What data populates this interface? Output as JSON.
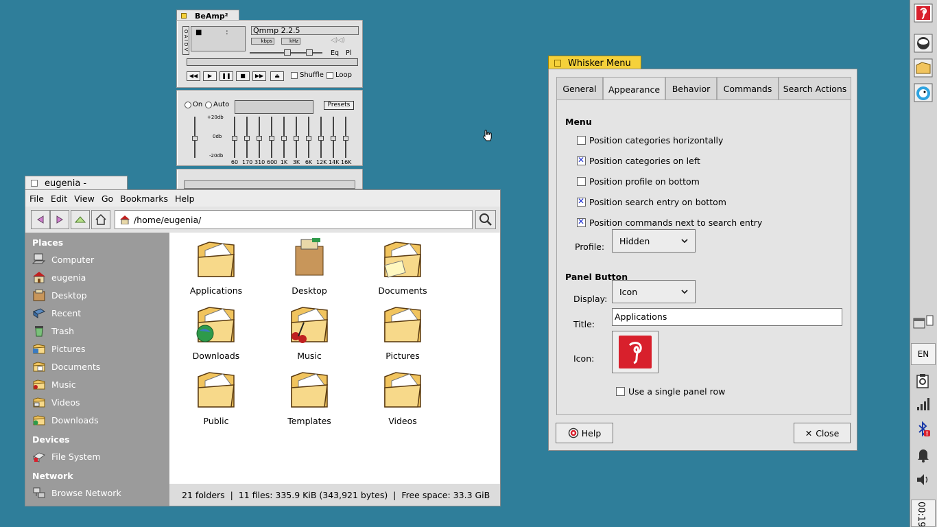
{
  "beamp": {
    "title": "BeAmp²",
    "track": "Qmmp 2.2.5",
    "kbps": "kbps",
    "khz": "kHz",
    "eq": "Eq",
    "pl": "Pl",
    "shuffle": "Shuffle",
    "loop": "Loop",
    "side_letters": "O A I D V",
    "time": ":",
    "eq_on": "On",
    "eq_auto": "Auto",
    "presets": "Presets",
    "db_top": "+20db",
    "db_mid": "0db",
    "db_bot": "-20db",
    "bands": [
      "60",
      "170",
      "310",
      "600",
      "1K",
      "3K",
      "6K",
      "12K",
      "14K",
      "16K"
    ]
  },
  "thunar": {
    "title": "eugenia - Thunar",
    "menu": [
      "File",
      "Edit",
      "View",
      "Go",
      "Bookmarks",
      "Help"
    ],
    "location": "/home/eugenia/",
    "places_header": "Places",
    "places": [
      "Computer",
      "eugenia",
      "Desktop",
      "Recent",
      "Trash",
      "Pictures",
      "Documents",
      "Music",
      "Videos",
      "Downloads"
    ],
    "devices_header": "Devices",
    "devices": [
      "File System"
    ],
    "network_header": "Network",
    "network": [
      "Browse Network"
    ],
    "folders": [
      "Applications",
      "Desktop",
      "Documents",
      "Downloads",
      "Music",
      "Pictures",
      "Public",
      "Templates",
      "Videos"
    ],
    "status": "21 folders  |  11 files: 335.9 KiB (343,921 bytes)  |  Free space: 33.3 GiB"
  },
  "whisker": {
    "title": "Whisker Menu",
    "tabs": [
      "General",
      "Appearance",
      "Behavior",
      "Commands",
      "Search Actions"
    ],
    "active_tab": "Appearance",
    "menu_header": "Menu",
    "options": [
      {
        "label": "Position categories horizontally",
        "checked": false
      },
      {
        "label": "Position categories on left",
        "checked": true
      },
      {
        "label": "Position profile on bottom",
        "checked": false
      },
      {
        "label": "Position search entry on bottom",
        "checked": true
      },
      {
        "label": "Position commands next to search entry",
        "checked": true
      }
    ],
    "profile_label": "Profile:",
    "profile_value": "Hidden",
    "panel_button_header": "Panel Button",
    "display_label": "Display:",
    "display_value": "Icon",
    "title_label": "Title:",
    "title_value": "Applications",
    "icon_label": "Icon:",
    "single_row_label": "Use a single panel row",
    "single_row_checked": false,
    "help_button": "Help",
    "close_button": "Close"
  },
  "panel": {
    "lang": "EN",
    "clock": "00:19"
  },
  "colors": {
    "desktop": "#2f7e9a",
    "title_tab_active": "#f5d13a",
    "sidebar": "#9a9a9a",
    "accent_red": "#d8202c"
  }
}
